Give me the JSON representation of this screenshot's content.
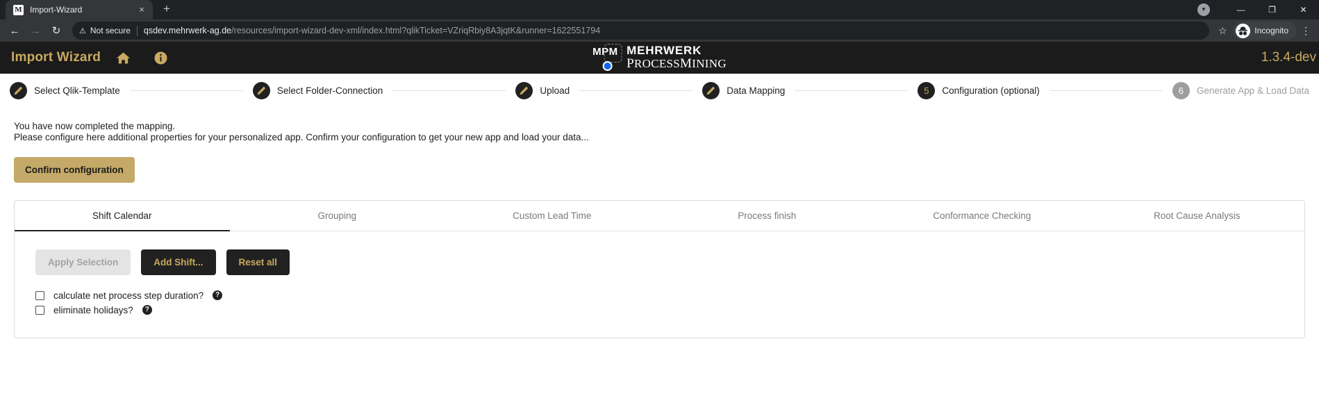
{
  "browser": {
    "tab": {
      "title": "Import-Wizard",
      "favicon_letter": "M",
      "close_label": "×"
    },
    "new_tab_label": "+",
    "window_controls": {
      "chevron": "▼",
      "minimize": "—",
      "maximize": "❐",
      "close": "✕"
    },
    "nav": {
      "back": "←",
      "forward": "→",
      "reload": "↻"
    },
    "omnibox": {
      "warning_icon": "⚠",
      "security_label": "Not secure",
      "url_host": "qsdev.mehrwerk-ag.de",
      "url_path": "/resources/import-wizard-dev-xml/index.html?qlikTicket=VZriqRbiy8A3jqtK&runner=1622551794",
      "bookmark_star": "☆"
    },
    "profile": {
      "label": "Incognito",
      "icon_glyph": "◑"
    },
    "menu_glyph": "⋮"
  },
  "header": {
    "title": "Import Wizard",
    "home_icon": "home-icon",
    "info_icon": "info-icon",
    "version": "1.3.4-dev",
    "logo": {
      "mark_text": "MPM",
      "line1": "MEHRWERK",
      "line2_cap": "P",
      "line2_rest": "ROCESS",
      "line2_cap2": "M",
      "line2_rest2": "INING"
    },
    "colors": {
      "accent": "#c9a961",
      "background": "#1b1b1b"
    }
  },
  "stepper": {
    "steps": [
      {
        "label": "Select Qlik-Template",
        "marker": "pencil",
        "state": "done"
      },
      {
        "label": "Select Folder-Connection",
        "marker": "pencil",
        "state": "done"
      },
      {
        "label": "Upload",
        "marker": "pencil",
        "state": "done"
      },
      {
        "label": "Data Mapping",
        "marker": "pencil",
        "state": "done"
      },
      {
        "label": "Configuration (optional)",
        "marker": "5",
        "state": "current"
      },
      {
        "label": "Generate App & Load Data",
        "marker": "6",
        "state": "inactive"
      }
    ]
  },
  "main": {
    "intro_line1": "You have now completed the mapping.",
    "intro_line2": "Please configure here additional properties for your personalized app. Confirm your configuration to get your new app and load your data...",
    "confirm_button": "Confirm configuration"
  },
  "card": {
    "tabs": [
      {
        "label": "Shift Calendar",
        "active": true
      },
      {
        "label": "Grouping",
        "active": false
      },
      {
        "label": "Custom Lead Time",
        "active": false
      },
      {
        "label": "Process finish",
        "active": false
      },
      {
        "label": "Conformance Checking",
        "active": false
      },
      {
        "label": "Root Cause Analysis",
        "active": false
      }
    ],
    "buttons": [
      {
        "label": "Apply Selection",
        "style": "disabled"
      },
      {
        "label": "Add Shift...",
        "style": "dark"
      },
      {
        "label": "Reset all",
        "style": "dark"
      }
    ],
    "checkboxes": [
      {
        "label": "calculate net process step duration?",
        "checked": false,
        "help": "?"
      },
      {
        "label": "eliminate holidays?",
        "checked": false,
        "help": "?"
      }
    ]
  }
}
